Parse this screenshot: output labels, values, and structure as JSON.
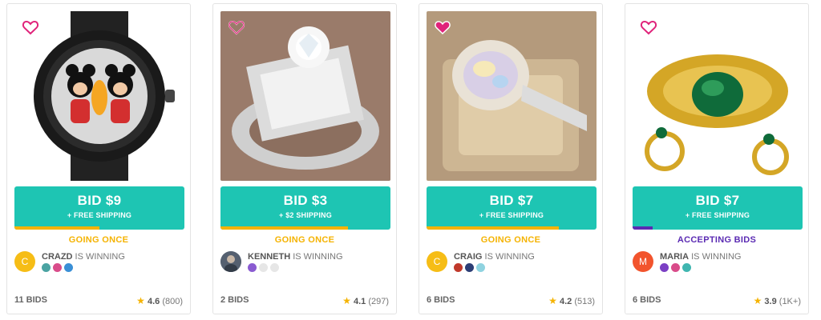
{
  "colors": {
    "accent": "#1ec5b3",
    "going": "#f5b301",
    "accepting": "#5b2bb3",
    "heart": "#e0237a"
  },
  "cards": [
    {
      "product_icon": "watch-image",
      "bid_label": "BID $9",
      "shipping": "+ FREE SHIPPING",
      "progress": 0.5,
      "progress_color": "#f5b301",
      "status": "GOING ONCE",
      "status_color": "#f5b301",
      "avatar_letter": "C",
      "avatar_color": "#f6bd16",
      "winner_name": "CRAZD",
      "winner_suffix": " IS WINNING",
      "bids": "11 BIDS",
      "rating": "4.6",
      "rating_count": "(800)"
    },
    {
      "product_icon": "diamond-ring-image",
      "bid_label": "BID $3",
      "shipping": "+ $2 SHIPPING",
      "progress": 0.75,
      "progress_color": "#f5b301",
      "status": "GOING ONCE",
      "status_color": "#f5b301",
      "avatar_letter": "",
      "avatar_color": "#556070",
      "winner_name": "KENNETH",
      "winner_suffix": " IS WINNING",
      "bids": "2 BIDS",
      "rating": "4.1",
      "rating_count": "(297)"
    },
    {
      "product_icon": "opal-ring-image",
      "bid_label": "BID $7",
      "shipping": "+ FREE SHIPPING",
      "progress": 0.78,
      "progress_color": "#f5b301",
      "status": "GOING ONCE",
      "status_color": "#f5b301",
      "avatar_letter": "C",
      "avatar_color": "#f6bd16",
      "winner_name": "CRAIG",
      "winner_suffix": " IS WINNING",
      "bids": "6 BIDS",
      "rating": "4.2",
      "rating_count": "(513)"
    },
    {
      "product_icon": "emerald-ring-image",
      "bid_label": "BID $7",
      "shipping": "+ FREE SHIPPING",
      "progress": 0.12,
      "progress_color": "#5b2bb3",
      "status": "ACCEPTING BIDS",
      "status_color": "#5b2bb3",
      "avatar_letter": "M",
      "avatar_color": "#f2542d",
      "winner_name": "MARIA",
      "winner_suffix": " IS WINNING",
      "bids": "6 BIDS",
      "rating": "3.9",
      "rating_count": "(1K+)"
    }
  ]
}
